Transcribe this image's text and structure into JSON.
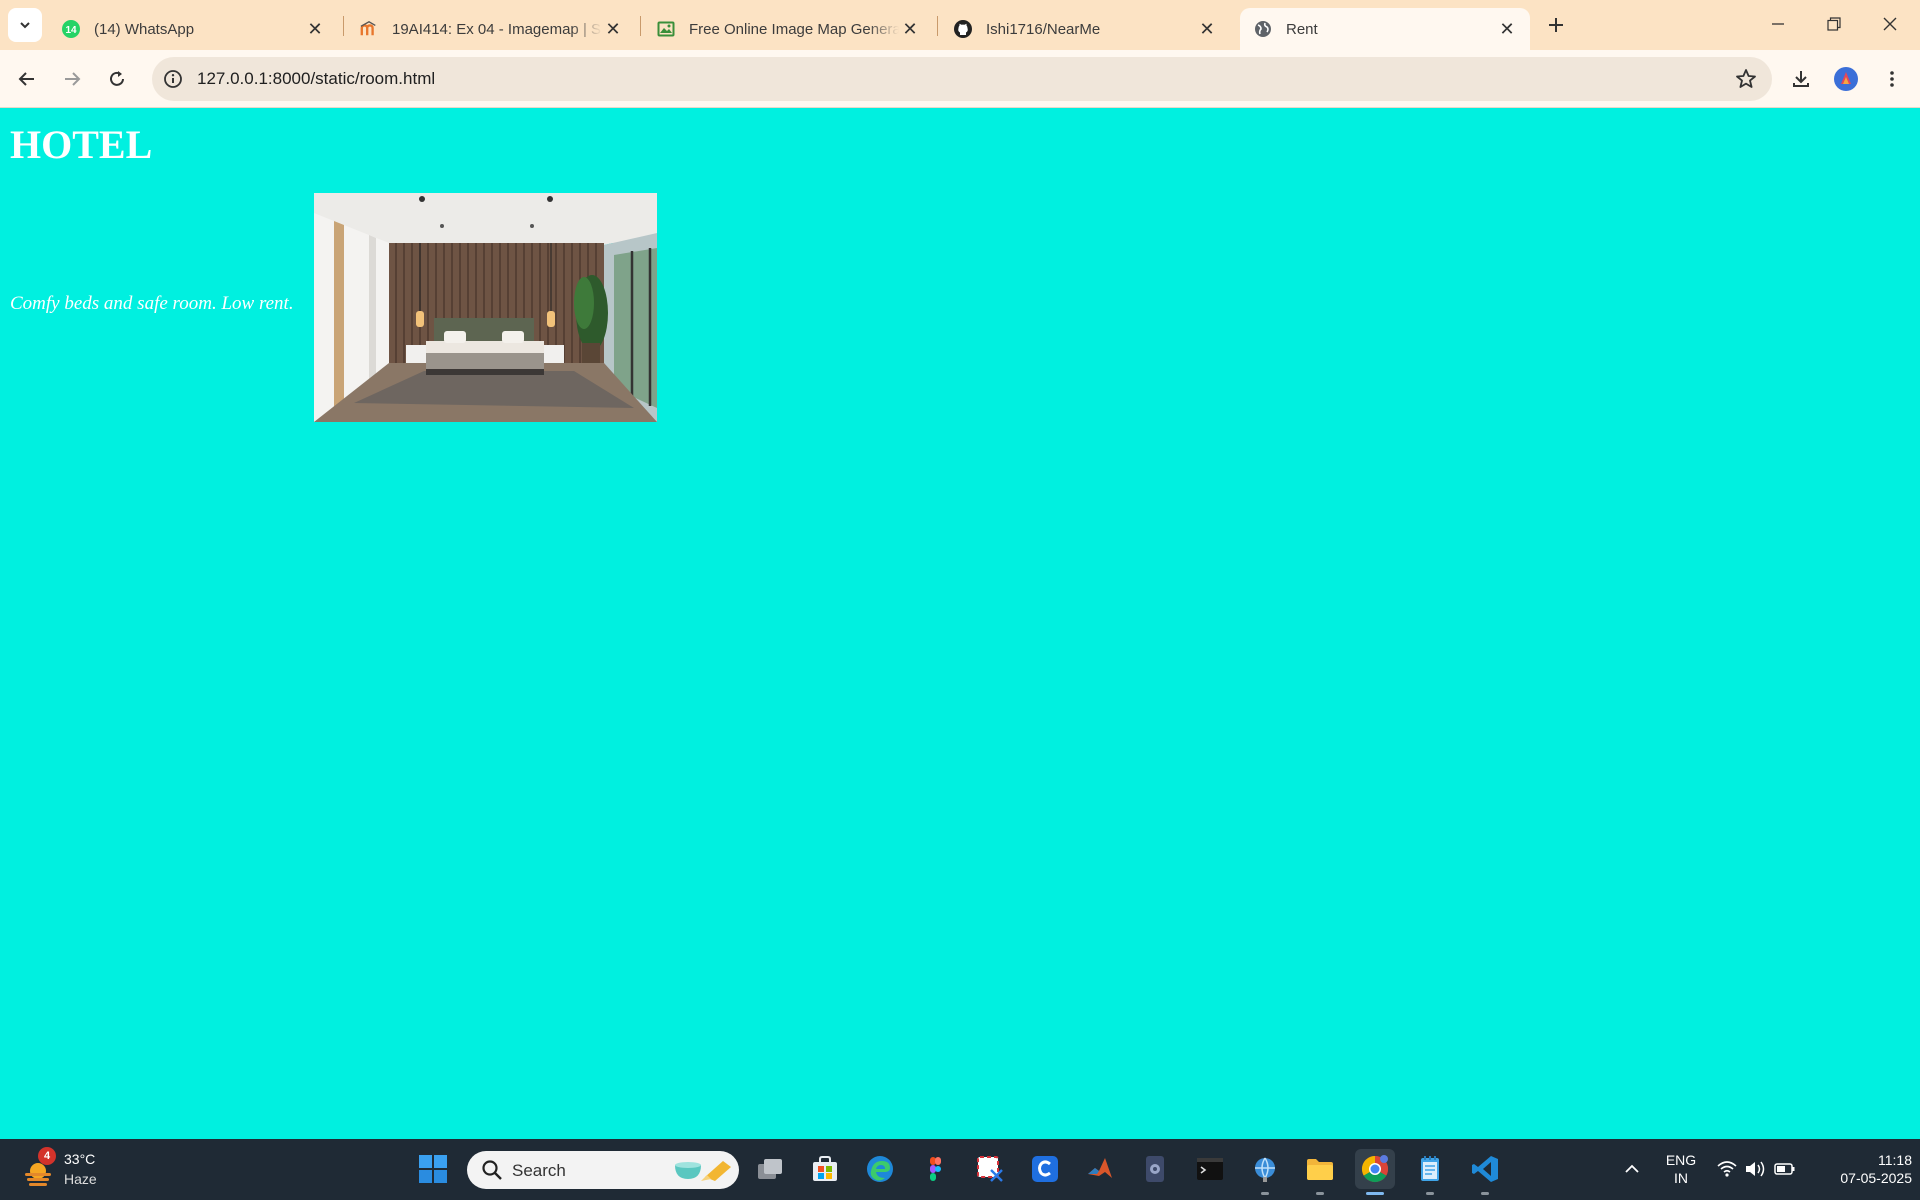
{
  "browser": {
    "tabs": [
      {
        "title": "(14) WhatsApp",
        "icon": "whatsapp-icon",
        "badge": "14"
      },
      {
        "title": "19AI414: Ex 04 - Imagemap | SE",
        "icon": "moodle-icon"
      },
      {
        "title": "Free Online Image Map Generat",
        "icon": "image-icon"
      },
      {
        "title": "Ishi1716/NearMe",
        "icon": "github-icon"
      },
      {
        "title": "Rent",
        "icon": "globe-icon",
        "active": true
      }
    ],
    "url": "127.0.0.1:8000/static/room.html"
  },
  "page": {
    "heading": "HOTEL",
    "caption": "Comfy beds and safe room. Low rent.",
    "background_color": "#00F0E0",
    "image": "bedroom-photo"
  },
  "taskbar": {
    "weather": {
      "temp": "33°C",
      "desc": "Haze",
      "badge": "4"
    },
    "search_label": "Search",
    "apps": [
      "file-explorer-icon",
      "microsoft-store-icon",
      "edge-icon",
      "figma-icon",
      "snipping-tool-icon",
      "canva-icon",
      "matlab-icon",
      "app-icon",
      "terminal-icon",
      "network-icon",
      "folder-icon",
      "chrome-icon",
      "notepad-icon",
      "vscode-icon"
    ],
    "language": {
      "line1": "ENG",
      "line2": "IN"
    },
    "clock": {
      "time": "11:18",
      "date": "07-05-2025"
    }
  }
}
